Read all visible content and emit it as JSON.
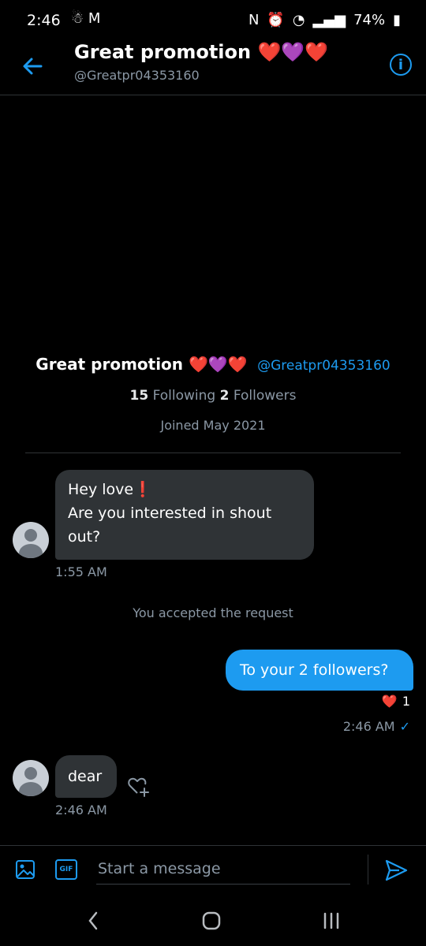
{
  "status_bar": {
    "time": "2:46",
    "left_icons": "☃ M",
    "wifi": "◔",
    "signal": "▂▄▆",
    "battery": "74%"
  },
  "header": {
    "title": "Great promotion ❤️💜❤️",
    "handle": "@Greatpr04353160",
    "info_glyph": "i"
  },
  "profile": {
    "name": "Great promotion ❤️💜❤️",
    "handle": "@Greatpr04353160",
    "following_count": "15",
    "following_label": "Following",
    "followers_count": "2",
    "followers_label": "Followers",
    "joined": "Joined May 2021"
  },
  "messages": {
    "m1_line1": "Hey love❗",
    "m1_line2": "Are you interested in shout",
    "m1_line3": "out?",
    "m1_time": "1:55 AM",
    "system": "You accepted the request",
    "m2_text": "To your 2 followers?",
    "m2_reaction": "❤️",
    "m2_reaction_count": "1",
    "m2_time": "2:46 AM",
    "m2_status": "✓",
    "m3_text": "dear",
    "m3_time": "2:46 AM"
  },
  "composer": {
    "gif_label": "GIF",
    "placeholder": "Start a message"
  },
  "colors": {
    "accent": "#1d9bf0",
    "bubble_in": "#2f3336",
    "background": "#000000"
  }
}
